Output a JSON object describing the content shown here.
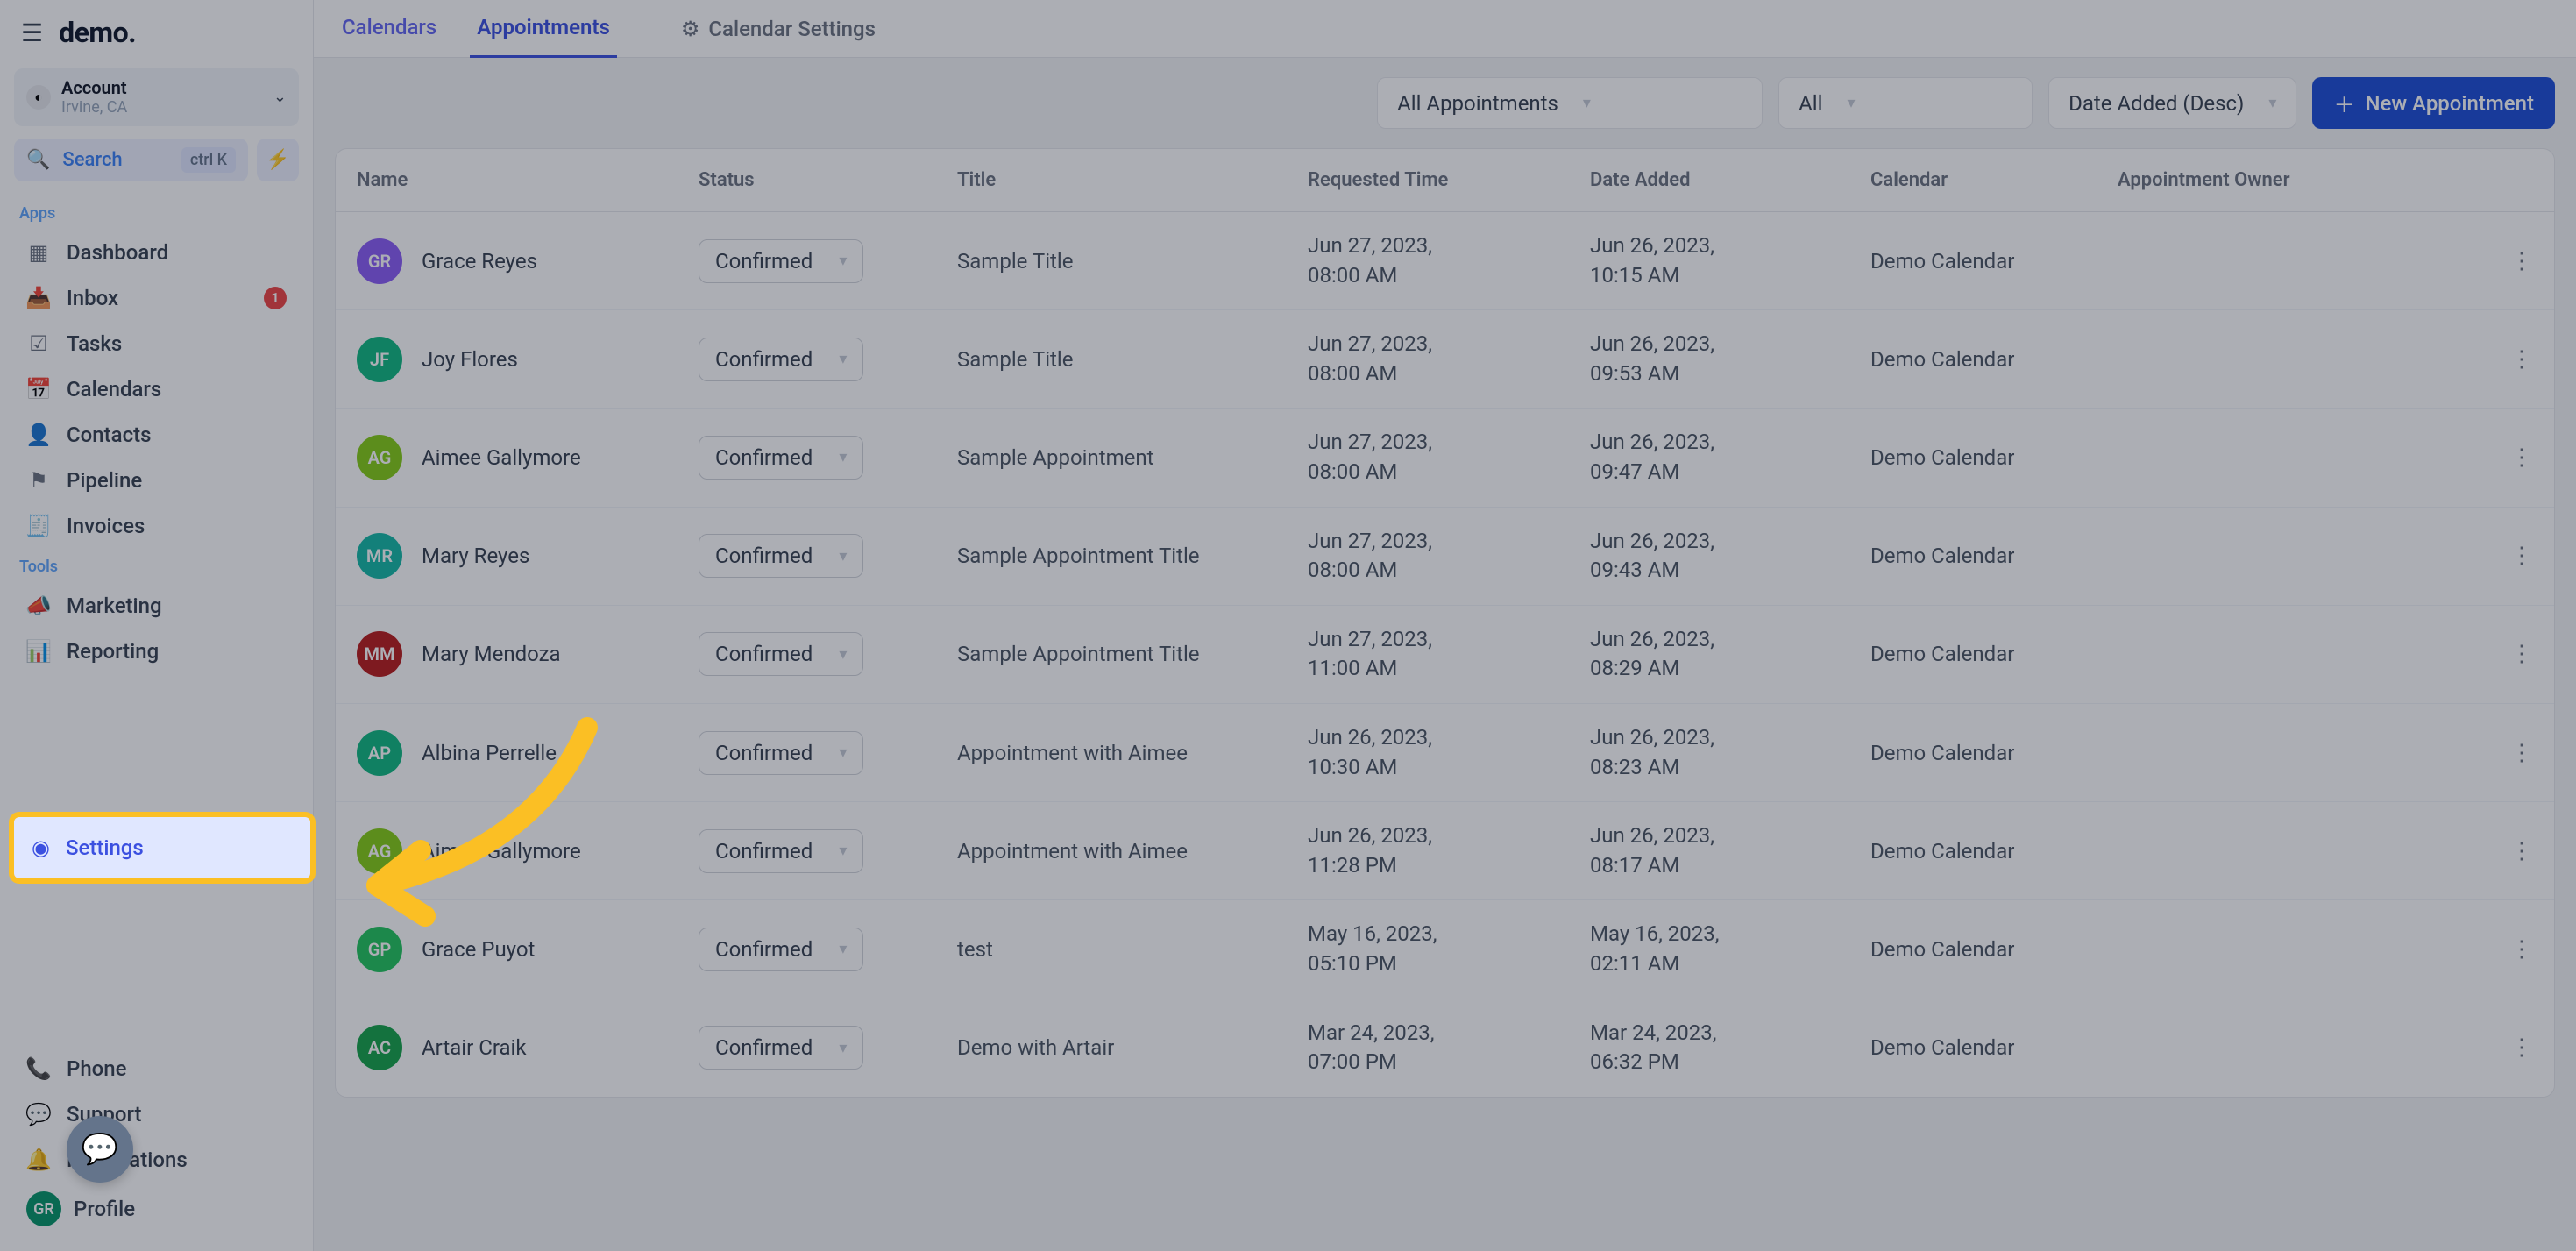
{
  "logo": "demo.",
  "account": {
    "label": "Account",
    "sub": "Irvine, CA"
  },
  "search": {
    "label": "Search",
    "shortcut": "ctrl K"
  },
  "sections": {
    "apps": "Apps",
    "tools": "Tools"
  },
  "nav": {
    "dashboard": "Dashboard",
    "inbox": "Inbox",
    "inbox_badge": "1",
    "tasks": "Tasks",
    "calendars": "Calendars",
    "contacts": "Contacts",
    "pipeline": "Pipeline",
    "invoices": "Invoices",
    "marketing": "Marketing",
    "reporting": "Reporting",
    "settings": "Settings",
    "phone": "Phone",
    "support": "Support",
    "notifications": "Notifications",
    "profile": "Profile"
  },
  "profile_initials": "GR",
  "tabs": {
    "calendars": "Calendars",
    "appointments": "Appointments",
    "settings": "Calendar Settings"
  },
  "filters": {
    "f1": "All Appointments",
    "f2": "All",
    "f3": "Date Added (Desc)"
  },
  "new_btn": "New Appointment",
  "columns": {
    "name": "Name",
    "status": "Status",
    "title": "Title",
    "req": "Requested Time",
    "added": "Date Added",
    "cal": "Calendar",
    "owner": "Appointment Owner"
  },
  "status_label": "Confirmed",
  "rows": [
    {
      "initials": "GR",
      "color": "#8b5cf6",
      "name": "Grace Reyes",
      "title": "Sample Title",
      "req": "Jun 27, 2023, 08:00 AM",
      "added": "Jun 26, 2023, 10:15 AM",
      "cal": "Demo Calendar"
    },
    {
      "initials": "JF",
      "color": "#10b981",
      "name": "Joy Flores",
      "title": "Sample Title",
      "req": "Jun 27, 2023, 08:00 AM",
      "added": "Jun 26, 2023, 09:53 AM",
      "cal": "Demo Calendar"
    },
    {
      "initials": "AG",
      "color": "#84cc16",
      "name": "Aimee Gallymore",
      "title": "Sample Appointment",
      "req": "Jun 27, 2023, 08:00 AM",
      "added": "Jun 26, 2023, 09:47 AM",
      "cal": "Demo Calendar"
    },
    {
      "initials": "MR",
      "color": "#14b8a6",
      "name": "Mary Reyes",
      "title": "Sample Appointment Title",
      "req": "Jun 27, 2023, 08:00 AM",
      "added": "Jun 26, 2023, 09:43 AM",
      "cal": "Demo Calendar"
    },
    {
      "initials": "MM",
      "color": "#b91c1c",
      "name": "Mary Mendoza",
      "title": "Sample Appointment Title",
      "req": "Jun 27, 2023, 11:00 AM",
      "added": "Jun 26, 2023, 08:29 AM",
      "cal": "Demo Calendar"
    },
    {
      "initials": "AP",
      "color": "#10b981",
      "name": "Albina Perrelle",
      "title": "Appointment with Aimee",
      "req": "Jun 26, 2023, 10:30 AM",
      "added": "Jun 26, 2023, 08:23 AM",
      "cal": "Demo Calendar"
    },
    {
      "initials": "AG",
      "color": "#84cc16",
      "name": "Aimee Gallymore",
      "title": "Appointment with Aimee",
      "req": "Jun 26, 2023, 11:28 PM",
      "added": "Jun 26, 2023, 08:17 AM",
      "cal": "Demo Calendar"
    },
    {
      "initials": "GP",
      "color": "#22c55e",
      "name": "Grace Puyot",
      "title": "test",
      "req": "May 16, 2023, 05:10 PM",
      "added": "May 16, 2023, 02:11 AM",
      "cal": "Demo Calendar"
    },
    {
      "initials": "AC",
      "color": "#16a34a",
      "name": "Artair Craik",
      "title": "Demo with Artair",
      "req": "Mar 24, 2023, 07:00 PM",
      "added": "Mar 24, 2023, 06:32 PM",
      "cal": "Demo Calendar"
    }
  ]
}
